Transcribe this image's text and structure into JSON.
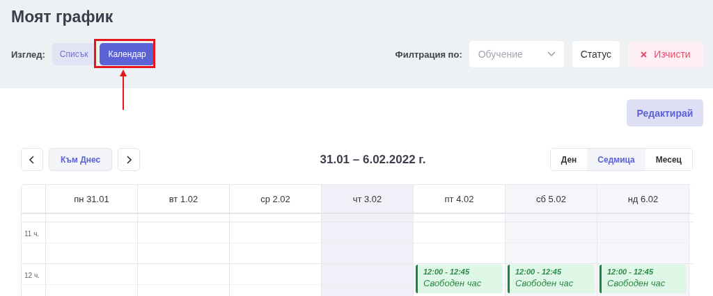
{
  "page_title": "Моят график",
  "view_switch": {
    "label": "Изглед:",
    "options": [
      {
        "label": "Списък",
        "selected": false
      },
      {
        "label": "Календар",
        "selected": true
      }
    ]
  },
  "filters": {
    "label": "Филтрация по:",
    "dropdown": {
      "placeholder": "Обучение"
    },
    "status_button": "Статус",
    "clear_button": "Изчисти"
  },
  "edit_button": "Редактирай",
  "toolbar": {
    "today_button": "Към Днес",
    "range": "31.01 – 6.02.2022 г.",
    "views": [
      {
        "label": "Ден",
        "selected": false
      },
      {
        "label": "Седмица",
        "selected": true
      },
      {
        "label": "Месец",
        "selected": false
      }
    ]
  },
  "calendar": {
    "days": [
      {
        "label": "пн 31.01",
        "kind": "weekday"
      },
      {
        "label": "вт 1.02",
        "kind": "weekday"
      },
      {
        "label": "ср 2.02",
        "kind": "weekday"
      },
      {
        "label": "чт 3.02",
        "kind": "today"
      },
      {
        "label": "пт 4.02",
        "kind": "weekday",
        "events": [
          {
            "time": "12:00 - 12:45",
            "title": "Свободен час"
          }
        ]
      },
      {
        "label": "сб 5.02",
        "kind": "weekend",
        "events": [
          {
            "time": "12:00 - 12:45",
            "title": "Свободен час"
          }
        ]
      },
      {
        "label": "нд 6.02",
        "kind": "weekend",
        "events": [
          {
            "time": "12:00 - 12:45",
            "title": "Свободен час"
          }
        ]
      }
    ],
    "hours": [
      {
        "label": "11 ч."
      },
      {
        "label": "12 ч."
      }
    ]
  }
}
